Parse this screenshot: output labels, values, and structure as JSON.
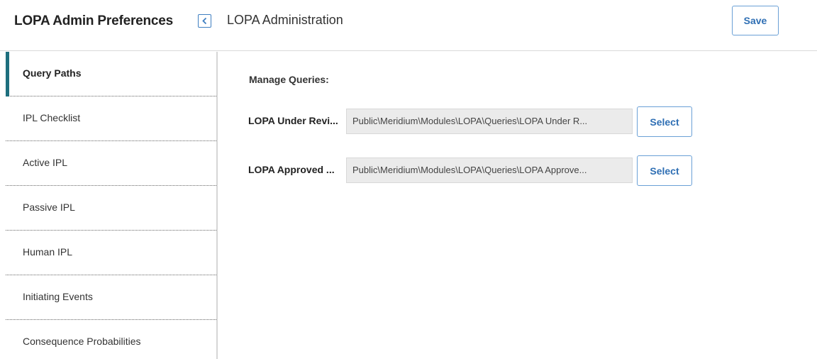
{
  "header": {
    "title": "LOPA Admin Preferences",
    "breadcrumb": "LOPA Administration",
    "save_label": "Save"
  },
  "sidebar": {
    "items": [
      {
        "label": "Query Paths",
        "active": true
      },
      {
        "label": "IPL Checklist"
      },
      {
        "label": "Active IPL"
      },
      {
        "label": "Passive IPL"
      },
      {
        "label": "Human IPL"
      },
      {
        "label": "Initiating Events"
      },
      {
        "label": "Consequence Probabilities"
      }
    ]
  },
  "main": {
    "section_title": "Manage Queries:",
    "rows": [
      {
        "label": "LOPA Under Revi...",
        "value": "Public\\Meridium\\Modules\\LOPA\\Queries\\LOPA Under R...",
        "button": "Select"
      },
      {
        "label": "LOPA Approved ...",
        "value": "Public\\Meridium\\Modules\\LOPA\\Queries\\LOPA Approve...",
        "button": "Select"
      }
    ]
  },
  "colors": {
    "accent": "#1e6f7e",
    "button_text": "#2f6fb4",
    "button_border": "#6aa0d6",
    "input_bg": "#ebebeb"
  },
  "icons": {
    "collapse": "chevron-left-icon"
  }
}
